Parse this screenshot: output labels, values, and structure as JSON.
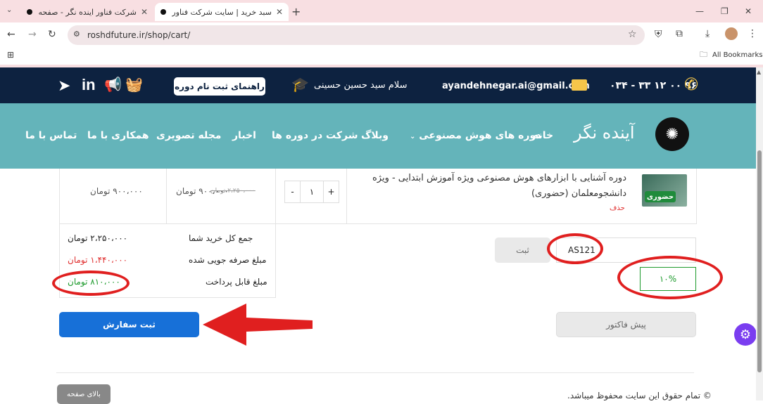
{
  "browser": {
    "tabs": [
      {
        "title": "شرکت فناور اینده نگر - صفحه اصلی",
        "active": false
      },
      {
        "title": "سبد خرید | سایت شرکت فناور آینده",
        "active": true
      }
    ],
    "url": "roshdfuture.ir/shop/cart/",
    "bookmarks_label": "All Bookmarks"
  },
  "topbar": {
    "phone": "۹۶ ۰۰ ۱۲ ۳۳ - ۰۳۴",
    "email": "ayandehnegar.ai@gmail.com",
    "greeting": "سلام سید حسین حسینی",
    "register_guide": "راهنمای ثبت نام دوره",
    "icons": [
      "phone-icon",
      "mail-icon",
      "graduation-cap-icon",
      "basket-icon",
      "megaphone-icon",
      "linkedin-icon",
      "telegram-icon"
    ]
  },
  "nav": {
    "brand": "آینده نگر",
    "items": [
      "خانه",
      "دوره های هوش مصنوعی",
      "وبلاگ",
      "شرکت در دوره ها",
      "اخبار",
      "مجله تصویری",
      "همکاری با ما",
      "تماس با ما"
    ],
    "colors": {
      "topbar": "#0d2240",
      "navbar": "#64b4ba"
    }
  },
  "cart": {
    "product": {
      "title": "دوره آشنایی با ابزارهای هوش مصنوعی ویژه آموزش ابتدایی - ویژه دانشجومعلمان (حضوری)",
      "badge": "حضوری",
      "remove": "حذف",
      "quantity": "۱",
      "old_price": "۲،۲۵۰،۰۰۰ تومان",
      "price": "۹۰۰،۰۰۰ تومان",
      "subtotal": "۹۰۰،۰۰۰ تومان"
    },
    "coupon": {
      "code": "AS121",
      "apply_label": "ثبت",
      "discount_percent": "۱۰%"
    },
    "totals": {
      "total_label": "جمع کل خرید شما",
      "total_value": "۲،۲۵۰،۰۰۰ تومان",
      "savings_label": "مبلغ صرفه جویی شده",
      "savings_value": "۱،۴۴۰،۰۰۰ تومان",
      "payable_label": "مبلغ قابل پرداخت",
      "payable_value": "۸۱۰،۰۰۰ تومان"
    },
    "submit_order": "ثبت سفارش",
    "pre_invoice": "پیش فاکتور"
  },
  "footer": {
    "copyright": "© تمام حقوق این سایت محفوظ میباشد.",
    "back_to_top": "بالای صفحه"
  }
}
